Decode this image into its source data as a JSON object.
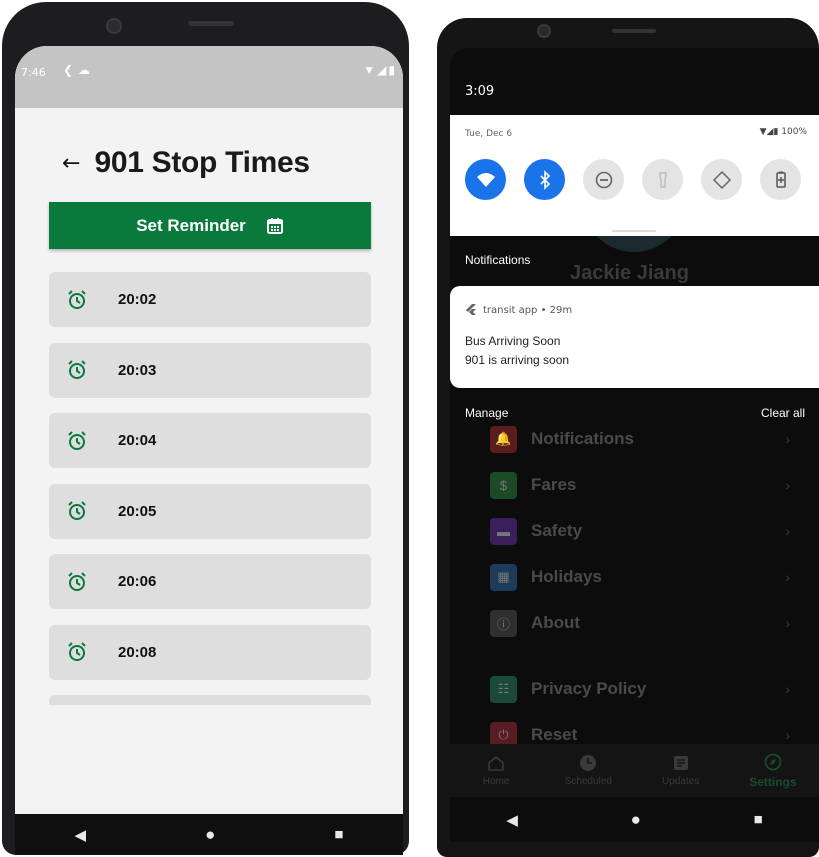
{
  "left_screen": {
    "status_bar": {
      "time": "7:46"
    },
    "title": "901 Stop Times",
    "reminder_button": {
      "label": "Set Reminder"
    },
    "stop_times": [
      "20:02",
      "20:03",
      "20:04",
      "20:05",
      "20:06",
      "20:08"
    ]
  },
  "right_screen": {
    "time": "3:09",
    "quick_settings": {
      "date": "Tue, Dec 6",
      "battery": "100%",
      "tiles": [
        "wifi-icon",
        "bluetooth-icon",
        "dnd-icon",
        "flashlight-icon",
        "autorotate-icon",
        "battery-saver-icon"
      ]
    },
    "notifications_label": "Notifications",
    "notification": {
      "app": "transit app • 29m",
      "title": "Bus Arriving Soon",
      "body": "901 is arriving soon"
    },
    "manage_label": "Manage",
    "clear_all_label": "Clear all",
    "background": {
      "user_name": "Jackie Jiang",
      "settings_items": [
        {
          "label": "Notifications",
          "icon_color": "#5a1c1c"
        },
        {
          "label": "Fares",
          "icon_color": "#1c4a24"
        },
        {
          "label": "Safety",
          "icon_color": "#3a1f5a"
        },
        {
          "label": "Holidays",
          "icon_color": "#1c3a5a"
        },
        {
          "label": "About",
          "icon_color": "#2f2f2f"
        },
        {
          "label": "Privacy Policy",
          "icon_color": "#1c4a3a"
        },
        {
          "label": "Reset",
          "icon_color": "#5a1c24"
        }
      ],
      "nav_tabs": [
        "Home",
        "Scheduled",
        "Updates",
        "Settings"
      ]
    }
  },
  "colors": {
    "brand_green": "#0a7a3c",
    "qs_blue": "#1a73e8",
    "list_item_bg": "#dedede"
  }
}
